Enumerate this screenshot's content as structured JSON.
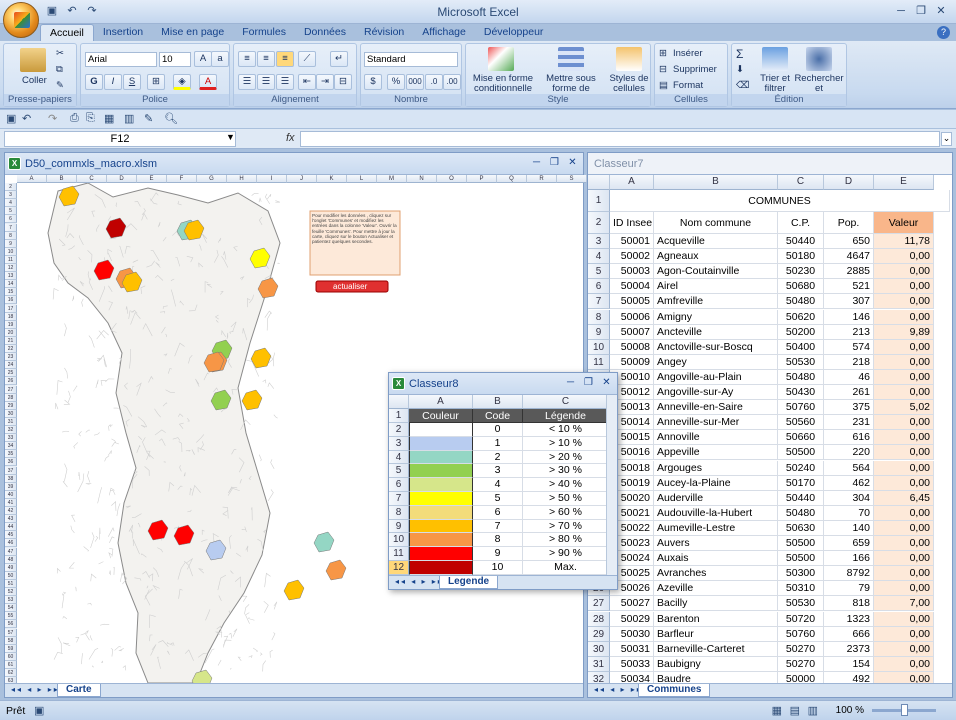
{
  "app": {
    "title": "Microsoft Excel"
  },
  "ribbon": {
    "tabs": [
      "Accueil",
      "Insertion",
      "Mise en page",
      "Formules",
      "Données",
      "Révision",
      "Affichage",
      "Développeur"
    ],
    "groups": {
      "clipboard": {
        "label": "Presse-papiers",
        "paste": "Coller"
      },
      "font": {
        "label": "Police",
        "font_name": "Arial",
        "font_size": "10",
        "bold": "G",
        "italic": "I",
        "underline": "S"
      },
      "alignment": {
        "label": "Alignement"
      },
      "number": {
        "label": "Nombre",
        "format": "Standard",
        "percent": "%",
        "thousands": "000"
      },
      "style": {
        "label": "Style",
        "cond_format": "Mise en forme conditionnelle",
        "table_format": "Mettre sous forme de tableau",
        "cell_styles": "Styles de cellules"
      },
      "cells": {
        "label": "Cellules",
        "insert": "Insérer",
        "delete": "Supprimer",
        "format": "Format"
      },
      "editing": {
        "label": "Édition",
        "sort": "Trier et filtrer",
        "find": "Rechercher et sélectionner"
      }
    }
  },
  "formula_bar": {
    "name_box": "F12",
    "fx": "fx",
    "content": ""
  },
  "win_map": {
    "title": "D50_commxls_macro.xlsm",
    "col_headers": [
      "A",
      "B",
      "C",
      "D",
      "E",
      "F",
      "G",
      "H",
      "I",
      "J",
      "K",
      "L",
      "M",
      "N",
      "O",
      "P",
      "Q",
      "R",
      "S"
    ],
    "note_text": "Pour modifier les données , cliquez sur l'onglet 'Communes' et modifiez les entrées dans la colonne 'Valeur'. Ouvrir la feuille 'Communes'. Pour mettre à jour la carte, cliquez sur le bouton Actualiser et patientez quelques secondes.",
    "link_text": "Ouvrir la feuille 'Communes'",
    "update_button": "actualiser",
    "sheet_tab": "Carte"
  },
  "win_communes": {
    "title": "Classeur7",
    "col_headers": [
      "A",
      "B",
      "C",
      "D",
      "E"
    ],
    "section_title": "COMMUNES",
    "headers": [
      "ID Insee",
      "Nom commune",
      "C.P.",
      "Pop.",
      "Valeur"
    ],
    "rows": [
      [
        "3",
        "50001",
        "Acqueville",
        "50440",
        "650",
        "11,78"
      ],
      [
        "4",
        "50002",
        "Agneaux",
        "50180",
        "4647",
        "0,00"
      ],
      [
        "5",
        "50003",
        "Agon-Coutainville",
        "50230",
        "2885",
        "0,00"
      ],
      [
        "6",
        "50004",
        "Airel",
        "50680",
        "521",
        "0,00"
      ],
      [
        "7",
        "50005",
        "Amfreville",
        "50480",
        "307",
        "0,00"
      ],
      [
        "8",
        "50006",
        "Amigny",
        "50620",
        "146",
        "0,00"
      ],
      [
        "9",
        "50007",
        "Ancteville",
        "50200",
        "213",
        "9,89"
      ],
      [
        "10",
        "50008",
        "Anctoville-sur-Boscq",
        "50400",
        "574",
        "0,00"
      ],
      [
        "11",
        "50009",
        "Angey",
        "50530",
        "218",
        "0,00"
      ],
      [
        "12",
        "50010",
        "Angoville-au-Plain",
        "50480",
        "46",
        "0,00"
      ],
      [
        "13",
        "50012",
        "Angoville-sur-Ay",
        "50430",
        "261",
        "0,00"
      ],
      [
        "14",
        "50013",
        "Anneville-en-Saire",
        "50760",
        "375",
        "5,02"
      ],
      [
        "15",
        "50014",
        "Anneville-sur-Mer",
        "50560",
        "231",
        "0,00"
      ],
      [
        "16",
        "50015",
        "Annoville",
        "50660",
        "616",
        "0,00"
      ],
      [
        "17",
        "50016",
        "Appeville",
        "50500",
        "220",
        "0,00"
      ],
      [
        "18",
        "50018",
        "Argouges",
        "50240",
        "564",
        "0,00"
      ],
      [
        "19",
        "50019",
        "Aucey-la-Plaine",
        "50170",
        "462",
        "0,00"
      ],
      [
        "20",
        "50020",
        "Auderville",
        "50440",
        "304",
        "6,45"
      ],
      [
        "21",
        "50021",
        "Audouville-la-Hubert",
        "50480",
        "70",
        "0,00"
      ],
      [
        "22",
        "50022",
        "Aumeville-Lestre",
        "50630",
        "140",
        "0,00"
      ],
      [
        "23",
        "50023",
        "Auvers",
        "50500",
        "659",
        "0,00"
      ],
      [
        "24",
        "50024",
        "Auxais",
        "50500",
        "166",
        "0,00"
      ],
      [
        "25",
        "50025",
        "Avranches",
        "50300",
        "8792",
        "0,00"
      ],
      [
        "26",
        "50026",
        "Azeville",
        "50310",
        "79",
        "0,00"
      ],
      [
        "27",
        "50027",
        "Bacilly",
        "50530",
        "818",
        "7,00"
      ],
      [
        "28",
        "50029",
        "Barenton",
        "50720",
        "1323",
        "0,00"
      ],
      [
        "29",
        "50030",
        "Barfleur",
        "50760",
        "666",
        "0,00"
      ],
      [
        "30",
        "50031",
        "Barneville-Carteret",
        "50270",
        "2373",
        "0,00"
      ],
      [
        "31",
        "50033",
        "Baubigny",
        "50270",
        "154",
        "0,00"
      ],
      [
        "32",
        "50034",
        "Baudre",
        "50000",
        "492",
        "0,00"
      ]
    ],
    "sheet_tab": "Communes"
  },
  "win_legend": {
    "title": "Classeur8",
    "col_headers": [
      "A",
      "B",
      "C"
    ],
    "headers": [
      "Couleur",
      "Code",
      "Légende"
    ],
    "rows": [
      {
        "row": "2",
        "color": "#ffffff",
        "code": "0",
        "label": "< 10 %"
      },
      {
        "row": "3",
        "color": "#b8ccf0",
        "code": "1",
        "label": "> 10 %"
      },
      {
        "row": "4",
        "color": "#94d6c4",
        "code": "2",
        "label": "> 20 %"
      },
      {
        "row": "5",
        "color": "#92d050",
        "code": "3",
        "label": "> 30 %"
      },
      {
        "row": "6",
        "color": "#d6e68a",
        "code": "4",
        "label": "> 40 %"
      },
      {
        "row": "7",
        "color": "#ffff00",
        "code": "5",
        "label": "> 50 %"
      },
      {
        "row": "8",
        "color": "#f3dc7a",
        "code": "6",
        "label": "> 60 %"
      },
      {
        "row": "9",
        "color": "#ffc000",
        "code": "7",
        "label": "> 70 %"
      },
      {
        "row": "10",
        "color": "#f79646",
        "code": "8",
        "label": "> 80 %"
      },
      {
        "row": "11",
        "color": "#ff0000",
        "code": "9",
        "label": "> 90 %"
      },
      {
        "row": "12",
        "color": "#c00000",
        "code": "10",
        "label": "Max."
      }
    ],
    "sheet_tab": "Legende"
  },
  "status": {
    "ready": "Prêt",
    "zoom": "100 %"
  }
}
